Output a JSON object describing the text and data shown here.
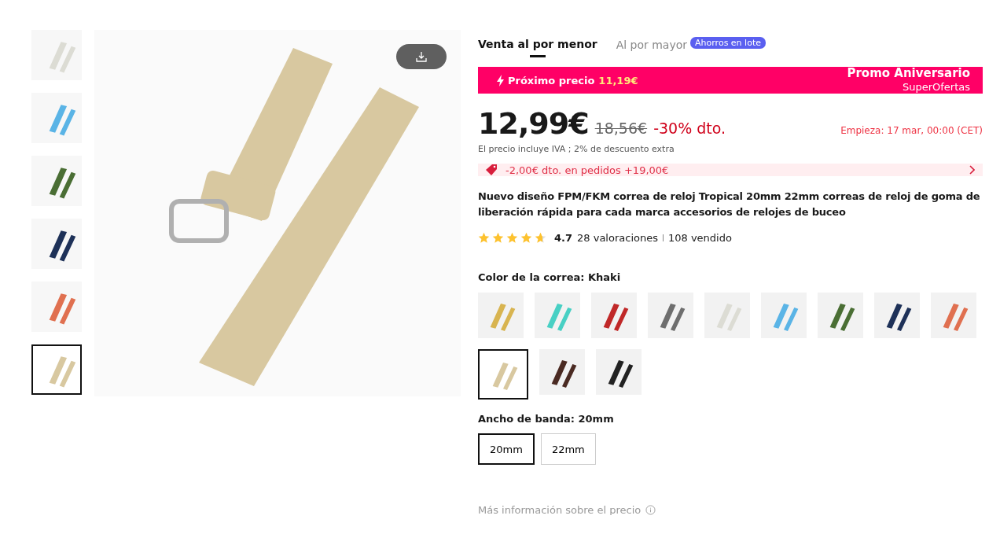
{
  "gallery": {
    "thumbnails": [
      {
        "color": "#dcdcd4",
        "selected": false
      },
      {
        "color": "#5ab4e6",
        "selected": false
      },
      {
        "color": "#4a6e34",
        "selected": false
      },
      {
        "color": "#1e3158",
        "selected": false
      },
      {
        "color": "#e07050",
        "selected": false
      },
      {
        "color": "#d8c8a0",
        "selected": true
      }
    ],
    "main_image": {
      "color": "#d8c8a0"
    }
  },
  "sale_tabs": [
    {
      "label": "Venta al por menor",
      "selected": true
    },
    {
      "label": "Al por mayor",
      "selected": false,
      "badge": "Ahorros en lote"
    }
  ],
  "promo_banner": {
    "label": "Próximo precio",
    "next_price": "11,19€",
    "title": "Promo Aniversario",
    "subtitle": "SuperOfertas"
  },
  "price": {
    "current": "12,99€",
    "original": "18,56€",
    "discount": "-30% dto.",
    "starts": "Empieza:  17 mar, 00:00 (CET)",
    "note": "El precio incluye IVA ; 2% de descuento extra"
  },
  "coupon": {
    "text": "-2,00€ dto. en pedidos +19,00€"
  },
  "title": "Nuevo diseño FPM/FKM correa de reloj Tropical 20mm 22mm correas de reloj de goma de liberación rápida para cada marca accesorios de relojes de buceo",
  "rating": {
    "stars": 4.7,
    "score": "4.7",
    "reviews": "28 valoraciones",
    "sold": "108 vendido"
  },
  "color_option": {
    "label": "Color de la correa: Khaki",
    "swatches": [
      {
        "color": "#d8b450",
        "selected": false
      },
      {
        "color": "#48d0c4",
        "selected": false
      },
      {
        "color": "#c02828",
        "selected": false
      },
      {
        "color": "#6e6e6e",
        "selected": false
      },
      {
        "color": "#dcdcd4",
        "selected": false
      },
      {
        "color": "#5ab4e6",
        "selected": false
      },
      {
        "color": "#4a6e34",
        "selected": false
      },
      {
        "color": "#1e3158",
        "selected": false
      },
      {
        "color": "#e07050",
        "selected": false
      },
      {
        "color": "#d8c8a0",
        "selected": true
      },
      {
        "color": "#4a2a22",
        "selected": false
      },
      {
        "color": "#222222",
        "selected": false
      }
    ]
  },
  "width_option": {
    "label": "Ancho de banda: 20mm",
    "options": [
      {
        "label": "20mm",
        "selected": true
      },
      {
        "label": "22mm",
        "selected": false
      }
    ]
  },
  "more_info": "Más información sobre el precio"
}
